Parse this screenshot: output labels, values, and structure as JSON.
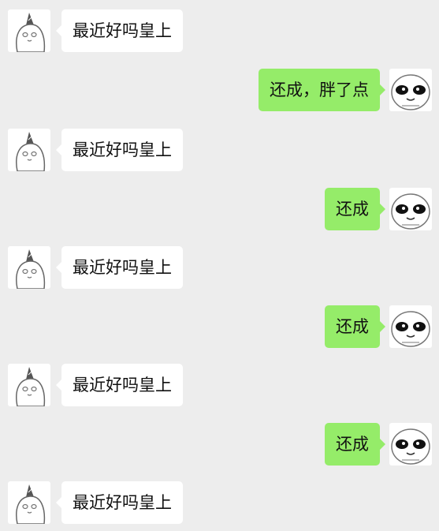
{
  "chat": {
    "messages": [
      {
        "side": "left",
        "text": "最近好吗皇上"
      },
      {
        "side": "right",
        "text": "还成，胖了点"
      },
      {
        "side": "left",
        "text": "最近好吗皇上"
      },
      {
        "side": "right",
        "text": "还成"
      },
      {
        "side": "left",
        "text": "最近好吗皇上"
      },
      {
        "side": "right",
        "text": "还成"
      },
      {
        "side": "left",
        "text": "最近好吗皇上"
      },
      {
        "side": "right",
        "text": "还成"
      },
      {
        "side": "left",
        "text": "最近好吗皇上"
      }
    ]
  },
  "colors": {
    "background": "#ededed",
    "incoming_bubble": "#ffffff",
    "outgoing_bubble": "#95ec69"
  },
  "icons": {
    "incoming_avatar": "party-hat-cartoon-avatar",
    "outgoing_avatar": "panda-face-meme-avatar"
  }
}
